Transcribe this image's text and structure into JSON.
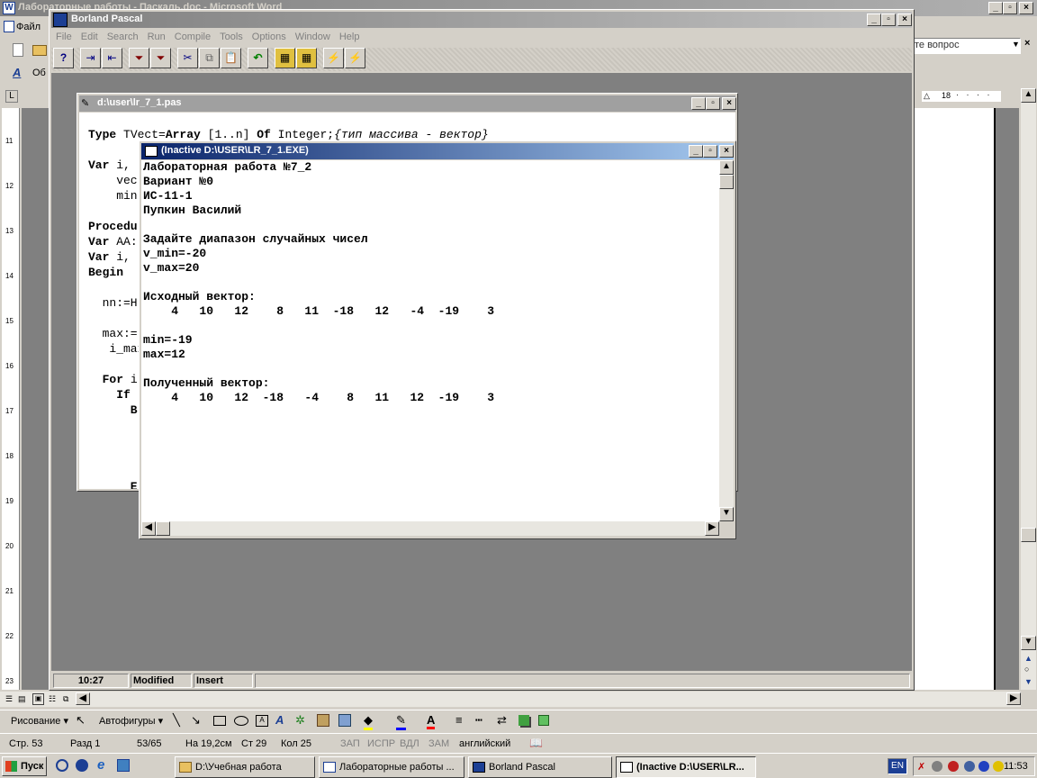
{
  "word": {
    "title": "Лабораторные работы - Паскаль.doc - Microsoft Word",
    "menu_file": "Файл",
    "help_placeholder": "те вопрос",
    "styles_partial": "Об",
    "drawing_label": "Рисование ▾",
    "autoshapes_label": "Автофигуры ▾",
    "ruler_num": "18",
    "ruler_v": [
      "11",
      "12",
      "13",
      "14",
      "15",
      "16",
      "17",
      "18",
      "19",
      "20",
      "21",
      "22",
      "23"
    ],
    "status": {
      "page": "Стр. 53",
      "section": "Разд 1",
      "pages": "53/65",
      "at": "На 19,2см",
      "line": "Ст 29",
      "col": "Кол 25",
      "rec": "ЗАП",
      "trk": "ИСПР",
      "ext": "ВДЛ",
      "ovr": "ЗАМ",
      "lang": "английский"
    }
  },
  "bp": {
    "title": "Borland Pascal",
    "menu": [
      "File",
      "Edit",
      "Search",
      "Run",
      "Compile",
      "Tools",
      "Options",
      "Window",
      "Help"
    ],
    "status": {
      "pos": "10:27",
      "modified": "Modified",
      "insert": "Insert"
    },
    "editor": {
      "title": "d:\\user\\lr_7_1.pas",
      "lines": [
        {
          "kw": "Type ",
          "rest": "TVect=",
          "kw2": "Array ",
          "rest2": "[1..n] ",
          "kw3": "Of ",
          "rest3": "Integer;",
          "cm": "{тип массива - вектор}"
        },
        {
          "kw": "Var ",
          "rest": "i,"
        },
        {
          "rest": "    vec"
        },
        {
          "rest": "    min"
        },
        {
          "kw": "Procedu"
        },
        {
          "kw": "Var ",
          "rest": "AA:"
        },
        {
          "kw": "Var ",
          "rest": "i,"
        },
        {
          "kw": "Begin"
        },
        {
          "rest": "  nn:=H"
        },
        {
          "rest": "  max:="
        },
        {
          "rest": "   i_max"
        },
        {
          "kw": "  For ",
          "rest": "i"
        },
        {
          "kw": "    If"
        },
        {
          "kw": "      B"
        },
        {
          "kw": "      E"
        }
      ]
    }
  },
  "console": {
    "title": "(Inactive D:\\USER\\LR_7_1.EXE)",
    "lines": [
      "Лабораторная работа №7_2",
      "Вариант №0",
      "ИС-11-1",
      "Пупкин Василий",
      "",
      "Задайте диапазон случайных чисел",
      "v_min=-20",
      "v_max=20",
      "",
      "Исходный вектор:",
      "    4   10   12    8   11  -18   12   -4  -19    3",
      "",
      "min=-19",
      "max=12",
      "",
      "Полученный вектор:",
      "    4   10   12  -18   -4    8   11   12  -19    3"
    ]
  },
  "taskbar": {
    "start": "Пуск",
    "tasks": [
      "D:\\Учебная работа",
      "Лабораторные работы ...",
      "Borland Pascal",
      "(Inactive D:\\USER\\LR..."
    ],
    "lang": "EN",
    "clock": "11:53"
  },
  "colors": {
    "titlebar": "#0a246a",
    "titlebar2": "#a6caf0",
    "desktop": "#808080",
    "keyword": "#000000",
    "comment": "#000000"
  }
}
